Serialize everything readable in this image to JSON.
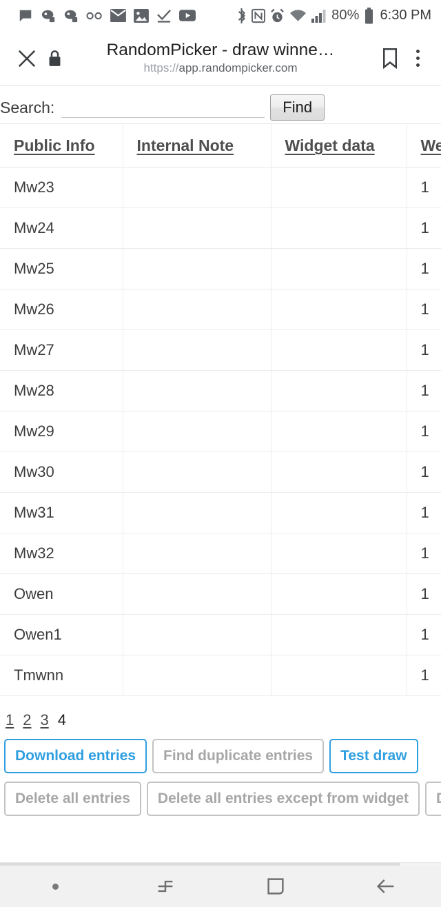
{
  "status_bar": {
    "left_icons": [
      "chat-icon",
      "discord-icon",
      "discord-icon",
      "voicemail-icon",
      "mail-icon",
      "photo-icon",
      "checkmark-icon",
      "youtube-icon"
    ],
    "right_icons": [
      "bluetooth-icon",
      "nfc-icon",
      "alarm-icon",
      "wifi-icon",
      "cell-signal-icon"
    ],
    "battery_percent": "80%",
    "time": "6:30 PM"
  },
  "browser": {
    "close_icon": "close-icon",
    "lock_icon": "lock-icon",
    "title": "RandomPicker - draw winne…",
    "url_scheme": "https://",
    "url_host": "app.randompicker.com",
    "bookmark_icon": "bookmark-icon",
    "menu_icon": "overflow-menu-icon"
  },
  "search": {
    "label": "Search:",
    "value": "",
    "placeholder": "",
    "find_label": "Find"
  },
  "table": {
    "headers": [
      "Public Info",
      "Internal Note",
      "Widget data",
      "We"
    ],
    "rows": [
      {
        "public_info": "Mw23",
        "internal_note": "",
        "widget_data": "",
        "weight": "1"
      },
      {
        "public_info": "Mw24",
        "internal_note": "",
        "widget_data": "",
        "weight": "1"
      },
      {
        "public_info": "Mw25",
        "internal_note": "",
        "widget_data": "",
        "weight": "1"
      },
      {
        "public_info": "Mw26",
        "internal_note": "",
        "widget_data": "",
        "weight": "1"
      },
      {
        "public_info": "Mw27",
        "internal_note": "",
        "widget_data": "",
        "weight": "1"
      },
      {
        "public_info": "Mw28",
        "internal_note": "",
        "widget_data": "",
        "weight": "1"
      },
      {
        "public_info": "Mw29",
        "internal_note": "",
        "widget_data": "",
        "weight": "1"
      },
      {
        "public_info": "Mw30",
        "internal_note": "",
        "widget_data": "",
        "weight": "1"
      },
      {
        "public_info": "Mw31",
        "internal_note": "",
        "widget_data": "",
        "weight": "1"
      },
      {
        "public_info": "Mw32",
        "internal_note": "",
        "widget_data": "",
        "weight": "1"
      },
      {
        "public_info": "Owen",
        "internal_note": "",
        "widget_data": "",
        "weight": "1"
      },
      {
        "public_info": "Owen1",
        "internal_note": "",
        "widget_data": "",
        "weight": "1"
      },
      {
        "public_info": "Tmwnn",
        "internal_note": "",
        "widget_data": "",
        "weight": "1"
      }
    ]
  },
  "pagination": {
    "pages": [
      "1",
      "2",
      "3",
      "4"
    ],
    "current": "4"
  },
  "actions": {
    "row1": [
      {
        "label": "Download entries",
        "style": "primary"
      },
      {
        "label": "Find duplicate entries",
        "style": "muted"
      },
      {
        "label": "Test draw",
        "style": "primary"
      }
    ],
    "row2": [
      {
        "label": "Delete all entries",
        "style": "muted"
      },
      {
        "label": "Delete all entries except from widget",
        "style": "muted"
      },
      {
        "label": "Delete all entries from widget",
        "style": "muted"
      }
    ]
  },
  "nav_bar": {
    "items": [
      "dot-indicator",
      "recents-icon",
      "home-icon",
      "back-icon"
    ]
  },
  "colors": {
    "accent_blue": "#2f9fe0",
    "muted_grey": "#a7a7a7",
    "text": "#3c3c3c"
  }
}
